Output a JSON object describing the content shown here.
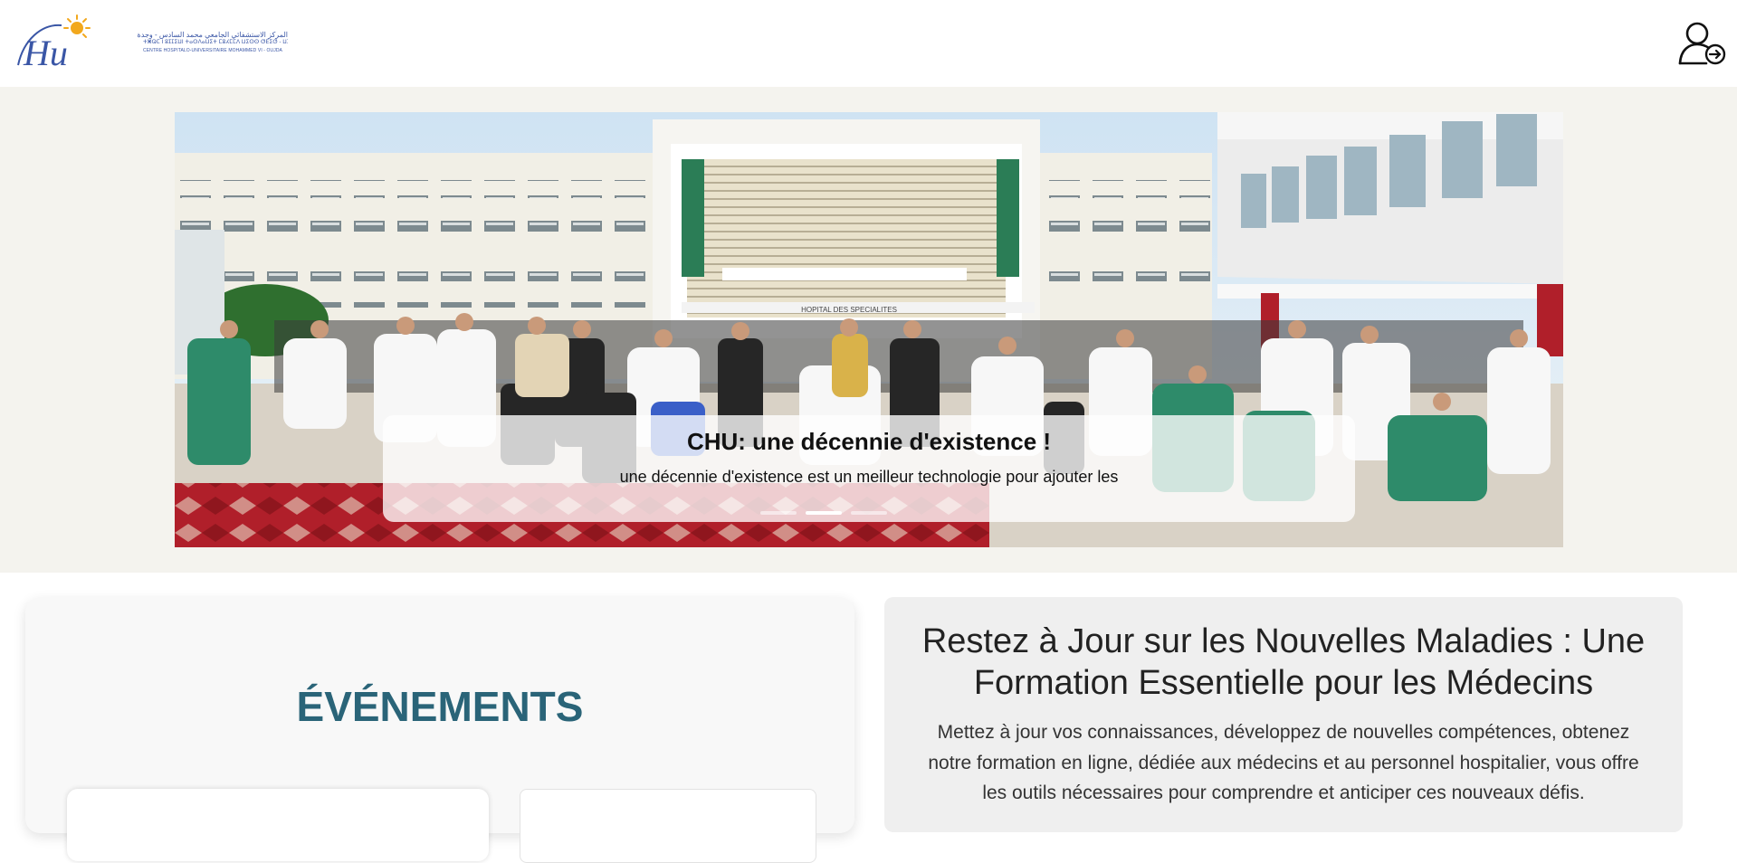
{
  "header": {
    "logo_letters": "Hu",
    "logo_text_arabic": "المركز الاستشفائي الجامعي محمد السادس - وجدة",
    "logo_text_tifinagh": "ⵜⵥⵕⵎ ⵏ ⵓⵊⵊⵉⵡⵏ ⵜⴰⵙⴷⴰⵡⵉⵜ ⵎⵓⵃⵎⵎⴷ ⵡⵉⵙⵙ ⵚⴹⵉⵚ - ⵡⵊⴷⴰ",
    "logo_text_french": "CENTRE HOSPITALO-UNIVERSITAIRE MOHAMMED VI - OUJDA",
    "user_icon": "user-login-icon"
  },
  "hero": {
    "building_sign": "HOPITAL DES SPECIALITES",
    "caption_title": "CHU: une décennie d'existence !",
    "caption_text": "une décennie d'existence est un meilleur technologie pour ajouter les",
    "active_slide": 1,
    "slide_count": 3
  },
  "events": {
    "title": "ÉVÉNEMENTS"
  },
  "training": {
    "title": "Restez à Jour sur les Nouvelles Maladies : Une Formation Essentielle pour les Médecins",
    "text": "Mettez à jour vos connaissances, développez de nouvelles compétences, obtenez notre formation en ligne, dédiée aux médecins et au personnel hospitalier, vous offre les outils nécessaires pour comprendre et anticiper ces nouveaux défis."
  },
  "colors": {
    "accent": "#2a6478",
    "logo_blue": "#3a56a6",
    "logo_sun": "#f2a81d",
    "hero_band": "#f4f3ee",
    "scrubs_green": "#2e8b6a"
  }
}
